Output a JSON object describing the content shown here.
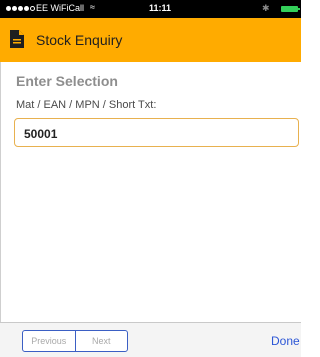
{
  "status_bar": {
    "carrier": "EE WiFiCall",
    "time": "11:11",
    "signal_icon": "signal-dots-icon",
    "wifi_icon": "wifi-icon",
    "bluetooth_icon": "bluetooth-icon",
    "battery_icon": "battery-icon"
  },
  "header": {
    "title": "Stock Enquiry",
    "icon": "document-icon",
    "background": "#ffab00"
  },
  "form": {
    "section_title": "Enter Selection",
    "field_label": "Mat / EAN / MPN / Short Txt:",
    "field_value": "50001"
  },
  "keyboard_toolbar": {
    "previous_label": "Previous",
    "next_label": "Next",
    "done_label": "Done"
  }
}
